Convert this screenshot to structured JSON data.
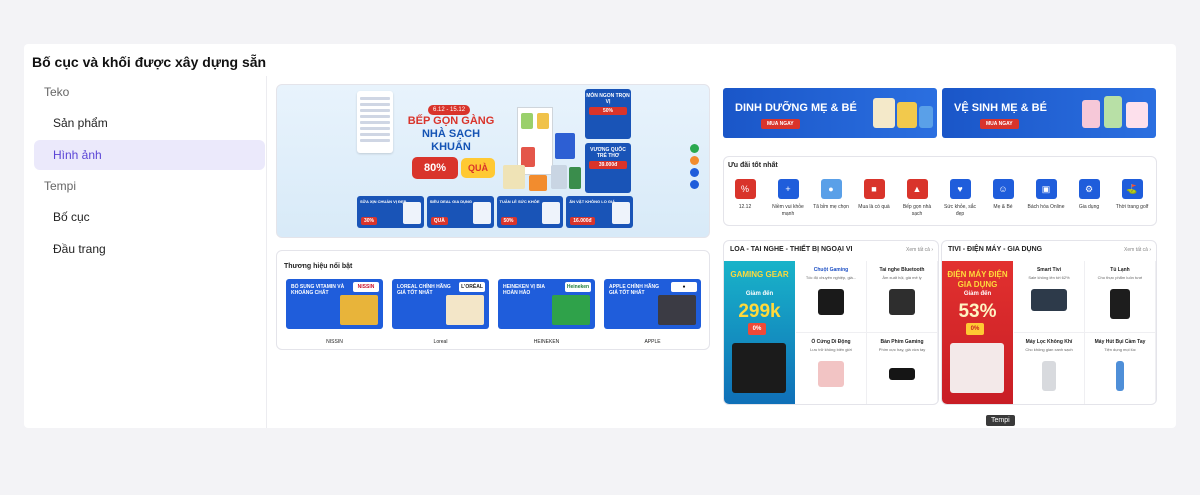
{
  "page": {
    "title": "Bố cục và khối được xây dựng sẵn"
  },
  "sidebar": {
    "groups": [
      {
        "label": "Teko",
        "items": [
          {
            "label": "Sản phẩm"
          },
          {
            "label": "Hình ảnh",
            "active": true
          }
        ]
      },
      {
        "label": "Tempi",
        "items": [
          {
            "label": "Bố cục"
          },
          {
            "label": "Đầu trang"
          }
        ]
      }
    ]
  },
  "hero": {
    "date_badge": "6.12 - 15.12",
    "headline_1": "BẾP GỌN GÀNG",
    "headline_2": "NHÀ SẠCH KHUẨN",
    "discount": "80%",
    "gift": "QUÀ",
    "side_promos": [
      {
        "title": "MÓN NGON TRỌN VỊ",
        "tag": "50%"
      },
      {
        "title": "VƯƠNG QUỐC TRẺ THƠ",
        "tag": "39.000đ"
      }
    ],
    "strip": [
      {
        "title": "SỮA XỊN CHUẨN VỊ ĐẸP",
        "pct": "30%"
      },
      {
        "title": "SIÊU DEAL GIA DỤNG",
        "pct": "QUÀ"
      },
      {
        "title": "TUẦN LỄ SỨC KHỎE",
        "pct": "50%"
      },
      {
        "title": "ĂN VẶT KHÔNG LO GIÁ",
        "pct": "16.000đ"
      }
    ]
  },
  "brands": {
    "title": "Thương hiệu nổi bật",
    "items": [
      {
        "text": "BỔ SUNG VITAMIN VÀ KHOÁNG CHẤT",
        "logo": "NISSIN",
        "name": "NISSIN",
        "img_color": "#e8b43a"
      },
      {
        "text": "LOREAL CHÍNH HÃNG GIÁ TỐT NHẤT",
        "logo": "L'ORÉAL",
        "name": "Loreal",
        "img_color": "#f3e6c8"
      },
      {
        "text": "HEINEKEN VỊ BIA HOÀN HẢO",
        "logo": "Heineken",
        "name": "HEINEKEN",
        "img_color": "#2fa24a"
      },
      {
        "text": "APPLE CHÍNH HÃNG GIÁ TỐT NHẤT",
        "logo": "",
        "name": "APPLE",
        "img_color": "#3b3b44"
      }
    ]
  },
  "right_banners": [
    {
      "title": "DINH DƯỠNG MẸ & BÉ",
      "button": "MUA NGAY"
    },
    {
      "title": "VỆ SINH MẸ & BÉ",
      "button": "MUA NGAY"
    }
  ],
  "deals": {
    "title": "Ưu đãi tốt nhất",
    "items": [
      {
        "label": "12.12",
        "icon": "sale-icon",
        "color": "#d9342b"
      },
      {
        "label": "Niềm vui khỏe mạnh",
        "icon": "health-icon",
        "color": "#1f5ddb"
      },
      {
        "label": "Tã bỉm mẹ chọn",
        "icon": "diaper-icon",
        "color": "#1f5ddb"
      },
      {
        "label": "Mua là có quà",
        "icon": "gift-icon",
        "color": "#d9342b"
      },
      {
        "label": "Bếp gọn nhà sạch",
        "icon": "kitchen-icon",
        "color": "#d9342b"
      },
      {
        "label": "Sức khỏe, sắc đẹp",
        "icon": "beauty-icon",
        "color": "#1f5ddb"
      },
      {
        "label": "Mẹ & Bé",
        "icon": "baby-icon",
        "color": "#1f5ddb"
      },
      {
        "label": "Bách hóa Online",
        "icon": "grocery-icon",
        "color": "#1f5ddb"
      },
      {
        "label": "Gia dụng",
        "icon": "appliance-icon",
        "color": "#1f5ddb"
      },
      {
        "label": "Thời trang golf",
        "icon": "golf-icon",
        "color": "#1f5ddb"
      }
    ]
  },
  "categories": [
    {
      "title": "LOA - TAI NGHE - THIẾT BỊ NGOẠI VI",
      "more": "Xem tất cả",
      "promo": {
        "heading": "GAMING GEAR",
        "sub": "Giảm đến",
        "big": "299k",
        "tag": "0%"
      },
      "products": [
        {
          "name": "Chuột Gaming",
          "desc": "Tốc độ chuyên nghiệp, giá...",
          "color": "#1a1a1a",
          "blue": true
        },
        {
          "name": "Tai nghe Bluetooth",
          "desc": "Âm xuất hội, giá mê ly",
          "color": "#2e2e2e"
        },
        {
          "name": "Ổ Cứng Di Động",
          "desc": "Lưu trữ không biên giới",
          "color": "#f2c4c4"
        },
        {
          "name": "Bàn Phím Gaming",
          "desc": "Phím cực hay, giá vừa tay",
          "color": "#151515"
        }
      ]
    },
    {
      "title": "TIVI - ĐIỆN MÁY - GIA DỤNG",
      "more": "Xem tất cả",
      "promo": {
        "heading": "ĐIỆN MÁY ĐIỆN GIA DỤNG",
        "sub": "Giảm đến",
        "big": "53%",
        "tag": "0%"
      },
      "products": [
        {
          "name": "Smart Tivi",
          "desc": "Sale không lên tới 62%",
          "color": "#2d3a4a"
        },
        {
          "name": "Tủ Lạnh",
          "desc": "Cho thực phẩm luôn tươi",
          "color": "#1d1d1d"
        },
        {
          "name": "Máy Lọc Không Khí",
          "desc": "Cho không gian xanh sạch",
          "color": "#d8dade"
        },
        {
          "name": "Máy Hút Bụi Cầm Tay",
          "desc": "Tiện dụng mọi lúc",
          "color": "#4f8fd8"
        }
      ]
    }
  ],
  "tooltip": "Tempi"
}
